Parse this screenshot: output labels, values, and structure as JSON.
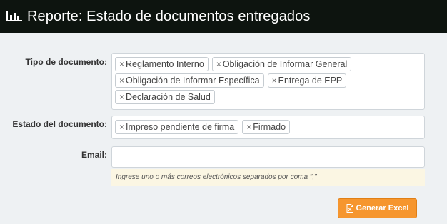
{
  "header": {
    "icon": "bar-chart-icon",
    "title": "Reporte: Estado de documentos entregados"
  },
  "form": {
    "tipo_documento": {
      "label": "Tipo de documento:",
      "tags": [
        "Reglamento Interno",
        "Obligación de Informar General",
        "Obligación de Informar Específica",
        "Entrega de EPP",
        "Declaración de Salud"
      ]
    },
    "estado_documento": {
      "label": "Estado del documento:",
      "tags": [
        "Impreso pendiente de firma",
        "Firmado"
      ]
    },
    "email": {
      "label": "Email:",
      "value": "",
      "help": "Ingrese uno o más correos electrónicos separados por coma \",\""
    },
    "tag_remove_glyph": "×",
    "submit": {
      "label": "Generar Excel",
      "icon": "excel-file-icon",
      "color": "#f6962e"
    }
  }
}
